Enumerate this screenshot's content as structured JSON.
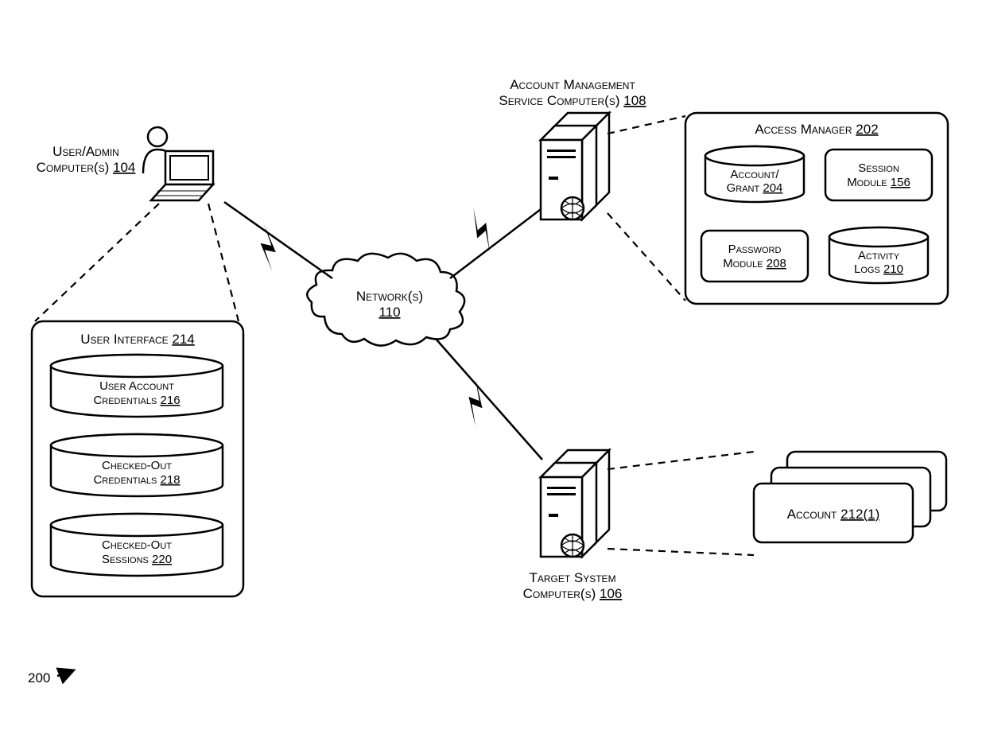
{
  "figure_ref": "200",
  "nodes": {
    "user_admin": {
      "label_line1": "User/Admin",
      "label_line2": "Computer(s)",
      "ref": "104"
    },
    "ams": {
      "label_line1": "Account Management",
      "label_line2": "Service Computer(s)",
      "ref": "108"
    },
    "target": {
      "label_line1": "Target System",
      "label_line2": "Computer(s)",
      "ref": "106"
    },
    "network": {
      "label": "Network(s)",
      "ref": "110"
    }
  },
  "user_interface": {
    "title": "User Interface",
    "ref": "214",
    "cylinders": [
      {
        "line1": "User Account",
        "line2": "Credentials",
        "ref": "216"
      },
      {
        "line1": "Checked-Out",
        "line2": "Credentials",
        "ref": "218"
      },
      {
        "line1": "Checked-Out",
        "line2": "Sessions",
        "ref": "220"
      }
    ]
  },
  "access_manager": {
    "title": "Access Manager",
    "ref": "202",
    "items": [
      {
        "kind": "cyl",
        "line1": "Account/",
        "line2": "Grant",
        "ref": "204"
      },
      {
        "kind": "rect",
        "line1": "Session",
        "line2": "Module",
        "ref": "156"
      },
      {
        "kind": "rect",
        "line1": "Password",
        "line2": "Module",
        "ref": "208"
      },
      {
        "kind": "cyl",
        "line1": "Activity",
        "line2": "Logs",
        "ref": "210"
      }
    ]
  },
  "account_card": {
    "label": "Account",
    "ref": "212(1)"
  }
}
